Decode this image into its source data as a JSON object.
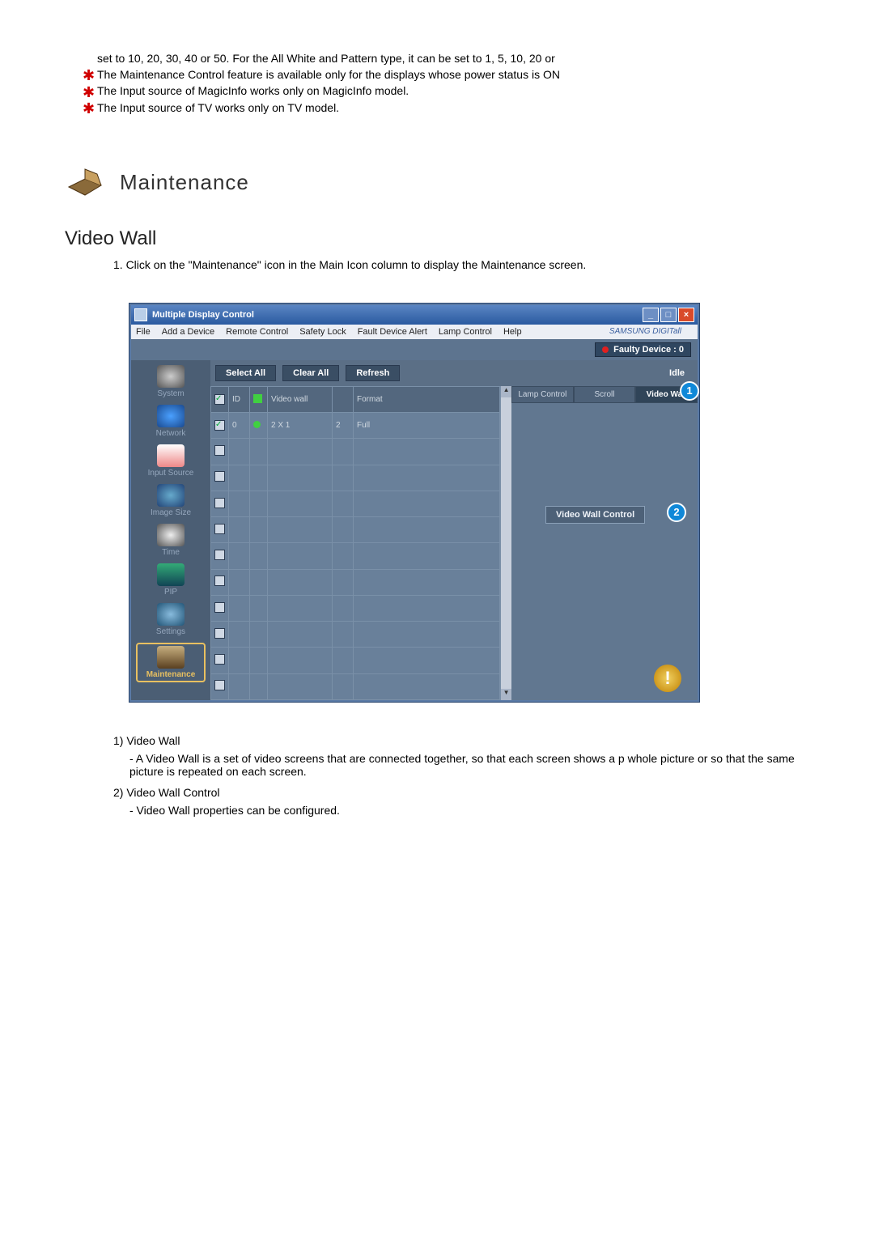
{
  "intro": {
    "line1": "set to 10, 20, 30, 40 or 50. For the All White and Pattern type, it can be set to 1, 5, 10, 20 or",
    "star_lines": [
      "The Maintenance Control feature is available only for the displays whose power status is ON",
      "The Input source of MagicInfo works only on MagicInfo model.",
      "The Input source of TV works only on TV model."
    ]
  },
  "section": {
    "title": "Maintenance"
  },
  "subsection": {
    "title": "Video Wall",
    "numbered": "1. Click on the \"Maintenance\" icon in the Main Icon column to display the Maintenance screen."
  },
  "app": {
    "title": "Multiple Display Control",
    "menus": [
      "File",
      "Add a Device",
      "Remote Control",
      "Safety Lock",
      "Fault Device Alert",
      "Lamp Control",
      "Help"
    ],
    "brand": "SAMSUNG DIGITall",
    "faulty": "Faulty Device : 0",
    "sidebar": [
      "System",
      "Network",
      "Input Source",
      "Image Size",
      "Time",
      "PIP",
      "Settings",
      "Maintenance"
    ],
    "actions": {
      "select_all": "Select All",
      "clear_all": "Clear All",
      "refresh": "Refresh",
      "idle": "Idle"
    },
    "grid": {
      "headers": {
        "check": "✓",
        "id": "ID",
        "status": "",
        "videowall": "Video wall",
        "unit": "",
        "format": "Format"
      },
      "row": {
        "id": "0",
        "videowall": "2 X 1",
        "unit": "2",
        "format": "Full"
      }
    },
    "right": {
      "tabs": [
        "Lamp Control",
        "Scroll",
        "Video Wall"
      ],
      "vwc_button": "Video Wall Control",
      "alert": "!"
    },
    "callouts": {
      "c1": "1",
      "c2": "2"
    }
  },
  "footnotes": {
    "f1_label": "1) Video Wall",
    "f1_text": "- A Video Wall is a set of video screens that are connected together, so that each screen shows a p whole picture or so that the same picture is repeated on each screen.",
    "f2_label": "2) Video Wall Control",
    "f2_text": "- Video Wall properties can be configured."
  }
}
